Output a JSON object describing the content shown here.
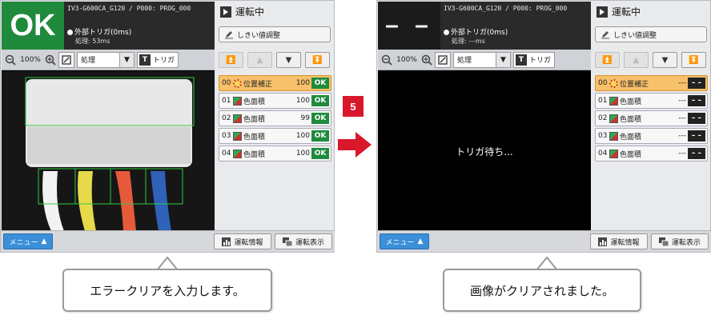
{
  "colors": {
    "ok_green": "#1f8a3c",
    "accent_red": "#d9182c",
    "menu_blue": "#3a8fd8",
    "selected_orange": "#f7c06b"
  },
  "step_number": "5",
  "left": {
    "judge": "OK",
    "model": "IV3-G600CA_G120",
    "program": "/ P000: PROG_000",
    "trigger": "外部トリガ(0ms)",
    "process_time": "処理: 53ms",
    "zoom": "100%",
    "mode": "処理",
    "trigger_btn": "トリガ",
    "status": "運転中",
    "threshold_btn": "しきい値調整",
    "menu": "メニュー",
    "run_info": "運転情報",
    "run_display": "運転表示",
    "tools": [
      {
        "idx": "00",
        "icon": "position-icon",
        "name": "位置補正",
        "score": "100",
        "result": "OK"
      },
      {
        "idx": "01",
        "icon": "area-icon",
        "name": "色面積",
        "score": "100",
        "result": "OK"
      },
      {
        "idx": "02",
        "icon": "area-icon",
        "name": "色面積",
        "score": "99",
        "result": "OK"
      },
      {
        "idx": "03",
        "icon": "area-icon",
        "name": "色面積",
        "score": "100",
        "result": "OK"
      },
      {
        "idx": "04",
        "icon": "area-icon",
        "name": "色面積",
        "score": "100",
        "result": "OK"
      }
    ],
    "caption": "エラークリアを入力します。"
  },
  "right": {
    "judge": "– –",
    "model": "IV3-G600CA_G120",
    "program": "/ P000: PROG_000",
    "trigger": "外部トリガ(0ms)",
    "process_time": "処理: ---ms",
    "zoom": "100%",
    "mode": "処理",
    "trigger_btn": "トリガ",
    "status": "運転中",
    "threshold_btn": "しきい値調整",
    "waiting_text": "トリガ待ち...",
    "menu": "メニュー",
    "run_info": "運転情報",
    "run_display": "運転表示",
    "tools": [
      {
        "idx": "00",
        "icon": "position-icon",
        "name": "位置補正",
        "score": "---",
        "result": "– –"
      },
      {
        "idx": "01",
        "icon": "area-icon",
        "name": "色面積",
        "score": "---",
        "result": "– –"
      },
      {
        "idx": "02",
        "icon": "area-icon",
        "name": "色面積",
        "score": "---",
        "result": "– –"
      },
      {
        "idx": "03",
        "icon": "area-icon",
        "name": "色面積",
        "score": "---",
        "result": "– –"
      },
      {
        "idx": "04",
        "icon": "area-icon",
        "name": "色面積",
        "score": "---",
        "result": "– –"
      }
    ],
    "caption": "画像がクリアされました。"
  }
}
